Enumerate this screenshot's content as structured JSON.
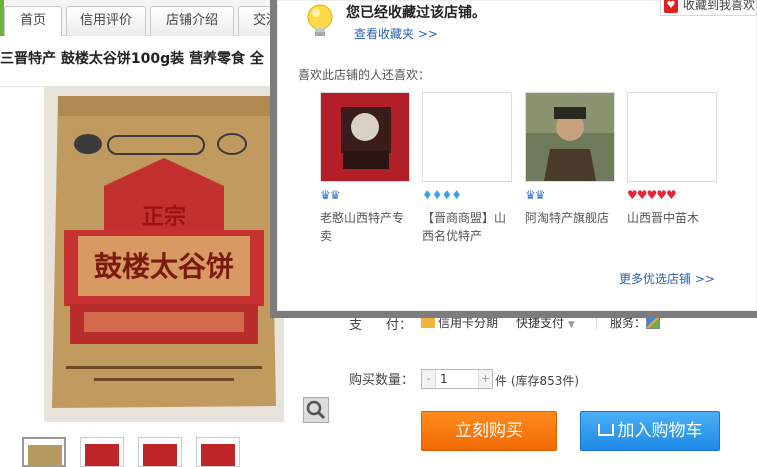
{
  "nav": {
    "tabs": [
      {
        "label": "首页"
      },
      {
        "label": "信用评价"
      },
      {
        "label": "店铺介绍"
      },
      {
        "label": "交流"
      }
    ]
  },
  "product": {
    "title": "三晋特产 鼓楼太谷饼100g装 营养零食 全",
    "image_icon": "product-photo",
    "zoom_icon": "magnifier-icon",
    "thumbnails": [
      "thumb-1",
      "thumb-2",
      "thumb-3",
      "thumb-4"
    ]
  },
  "payment": {
    "label_1": "支",
    "label_2": "付：",
    "credit": "信用卡分期",
    "quick": "快捷支付",
    "service_label": "服务："
  },
  "quantity": {
    "label": "购买数量：",
    "minus": "-",
    "value": "1",
    "plus": "+",
    "unit_stock": "件 (库存853件)"
  },
  "buttons": {
    "buy": "立刻购买",
    "cart": "加入购物车"
  },
  "popup": {
    "message": "您已经收藏过该店铺。",
    "view_link": "查看收藏夹 >>",
    "also_like": "喜欢此店铺的人还喜欢：",
    "shops": [
      {
        "name": "老憨山西特产专卖",
        "rating": "crown",
        "rating_count": 2
      },
      {
        "name": "【晋商商盟】山西名优特产",
        "rating": "diamond",
        "rating_count": 4
      },
      {
        "name": "阿淘特产旗舰店",
        "rating": "crown",
        "rating_count": 2
      },
      {
        "name": "山西晋中苗木",
        "rating": "heart",
        "rating_count": 5
      }
    ],
    "more_link": "更多优选店铺 >>"
  },
  "fav_button": {
    "label": "收藏到我喜欢"
  },
  "colors": {
    "buy": "#f26a05",
    "cart": "#1d8ae6",
    "link": "#2a63b5"
  }
}
